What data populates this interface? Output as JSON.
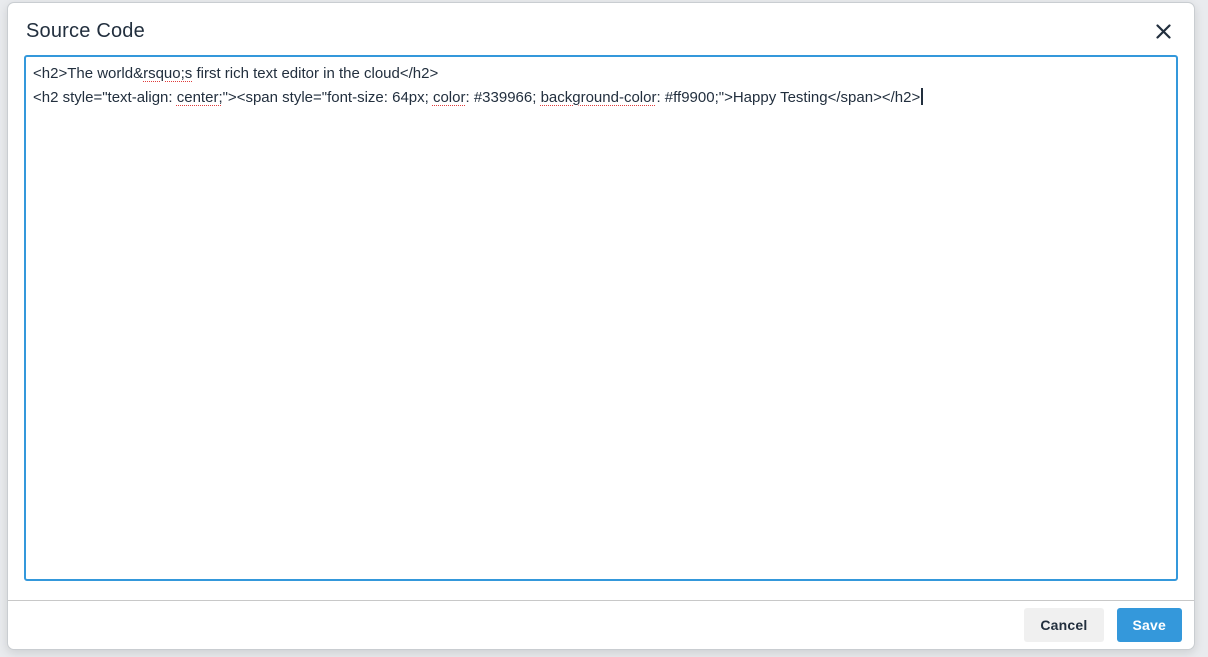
{
  "dialog": {
    "title": "Source Code"
  },
  "icons": {
    "close": "close-icon"
  },
  "editor": {
    "caret_visible": true,
    "lines": [
      {
        "segments": [
          {
            "text": "<h2>The world&",
            "misspelled": false
          },
          {
            "text": "rsquo;s",
            "misspelled": true
          },
          {
            "text": " first rich text editor in the cloud</h2>",
            "misspelled": false
          }
        ]
      },
      {
        "segments": [
          {
            "text": "<h2 style=\"text-align: ",
            "misspelled": false
          },
          {
            "text": "center;",
            "misspelled": true
          },
          {
            "text": "\"><span style=\"font-size: 64px; ",
            "misspelled": false
          },
          {
            "text": "color",
            "misspelled": true
          },
          {
            "text": ": #339966; ",
            "misspelled": false
          },
          {
            "text": "background-color",
            "misspelled": true
          },
          {
            "text": ": #ff9900;\">Happy Testing</span></h2>",
            "misspelled": false
          }
        ]
      }
    ]
  },
  "footer": {
    "cancel_label": "Cancel",
    "save_label": "Save"
  },
  "colors": {
    "accent": "#3498db",
    "text": "#222f3e",
    "cancel_bg": "#f0f0f0",
    "divider": "#c8c8c8",
    "spellcheck": "#e03c3c",
    "backdrop": "#e9ebee"
  }
}
